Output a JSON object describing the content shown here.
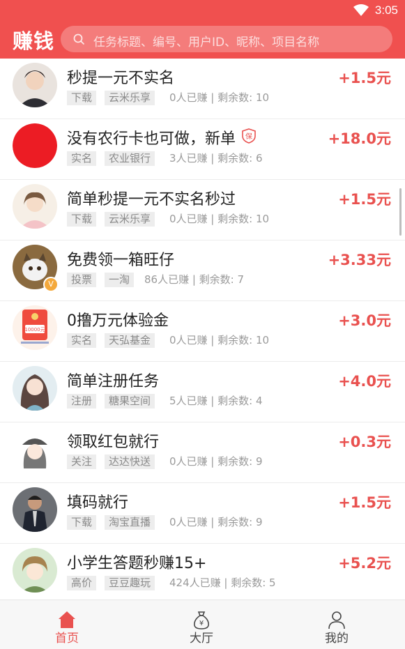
{
  "status": {
    "time": "3:05"
  },
  "header": {
    "title": "赚钱",
    "search_placeholder": "任务标题、编号、用户ID、昵称、项目名称"
  },
  "colors": {
    "brand": "#f0504f",
    "reward": "#e9514f",
    "tag_bg": "#ededed",
    "nav_active": "#e9514f"
  },
  "tasks": [
    {
      "title": "秒提一元不实名",
      "tags": [
        "下载",
        "云米乐享"
      ],
      "stats": "0人已赚 | 剩余数: 10",
      "reward": "+1.5元",
      "avatar": "young-man-photo"
    },
    {
      "title": "没有农行卡也可做，新单",
      "tags": [
        "实名",
        "农业银行"
      ],
      "stats": "3人已赚 | 剩余数: 6",
      "reward": "+18.0元",
      "avatar": "red-circle",
      "guarantee_icon_text": "保"
    },
    {
      "title": "简单秒提一元不实名秒过",
      "tags": [
        "下载",
        "云米乐享"
      ],
      "stats": "0人已赚 | 剩余数: 10",
      "reward": "+1.5元",
      "avatar": "girl-photo"
    },
    {
      "title": "免费领一箱旺仔",
      "tags": [
        "投票",
        "一淘"
      ],
      "stats": "86人已赚 | 剩余数: 7",
      "reward": "+3.33元",
      "avatar": "cat-photo",
      "verified_badge": "V"
    },
    {
      "title": "0撸万元体验金",
      "tags": [
        "实名",
        "天弘基金"
      ],
      "stats": "0人已赚 | 剩余数: 10",
      "reward": "+3.0元",
      "avatar": "red-envelope-app",
      "avatar_text": "10000元"
    },
    {
      "title": "简单注册任务",
      "tags": [
        "注册",
        "糖果空间"
      ],
      "stats": "5人已赚 | 剩余数: 4",
      "reward": "+4.0元",
      "avatar": "anime-girl-long-hair"
    },
    {
      "title": "领取红包就行",
      "tags": [
        "关注",
        "达达快送"
      ],
      "stats": "0人已赚 | 剩余数: 9",
      "reward": "+0.3元",
      "avatar": "anime-girl-hat"
    },
    {
      "title": "填码就行",
      "tags": [
        "下载",
        "淘宝直播"
      ],
      "stats": "0人已赚 | 剩余数: 9",
      "reward": "+1.5元",
      "avatar": "man-suit-photo"
    },
    {
      "title": "小学生答题秒赚15+",
      "tags": [
        "高价",
        "豆豆趣玩"
      ],
      "stats": "424人已赚 | 剩余数: 5",
      "reward": "+5.2元",
      "avatar": "anime-boy"
    }
  ],
  "nav": [
    {
      "label": "首页",
      "icon": "home-icon",
      "active": true
    },
    {
      "label": "大厅",
      "icon": "money-bag-icon",
      "active": false
    },
    {
      "label": "我的",
      "icon": "person-icon",
      "active": false
    }
  ]
}
